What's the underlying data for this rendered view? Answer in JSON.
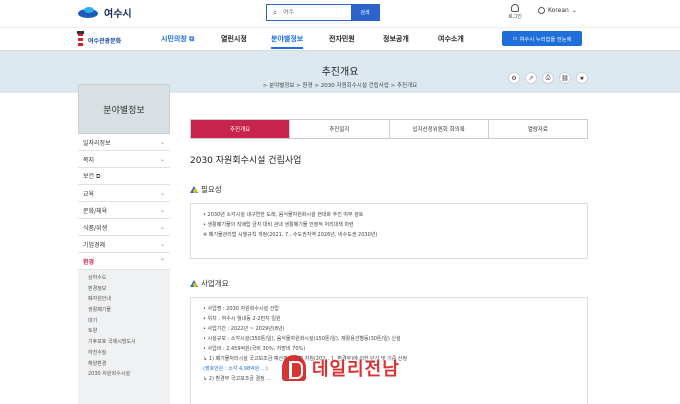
{
  "header": {
    "logo_text": "여수시",
    "search_placeholder": "여수",
    "search_button": "검색",
    "login_label": "로그인",
    "language_label": "Korean"
  },
  "nav": {
    "brand_label": "여수관광문화",
    "items": [
      {
        "label": "시민의창 ⧉"
      },
      {
        "label": "열린시정"
      },
      {
        "label": "분야별정보"
      },
      {
        "label": "전자민원"
      },
      {
        "label": "정보공개"
      },
      {
        "label": "여수소개"
      }
    ],
    "cta_label": "여수시 누리집을 한눈에"
  },
  "banner": {
    "title": "추진개요",
    "breadcrumb": "> 분야별정보 > 환경 > 2030 자원회수시설 건립사업 > 추진개요"
  },
  "sidebar": {
    "title": "분야별정보",
    "items": [
      {
        "label": "일자리정보"
      },
      {
        "label": "복지"
      },
      {
        "label": "보건 ⧉"
      },
      {
        "label": "교육"
      },
      {
        "label": "문화/체육"
      },
      {
        "label": "식품/위생"
      },
      {
        "label": "기업경제"
      },
      {
        "label": "환경"
      }
    ],
    "subitems": [
      "상하수도",
      "환경정보",
      "폐자원안내",
      "생활폐기물",
      "대기",
      "토양",
      "기후보호 국제시범도시",
      "하천수질",
      "해양환경",
      "2030 자원회수시설"
    ]
  },
  "tabs": [
    {
      "label": "추진개요"
    },
    {
      "label": "추진일지"
    },
    {
      "label": "입지선정위원회 회의록"
    },
    {
      "label": "열람자료"
    }
  ],
  "page_title": "2030 자원회수시설 건립사업",
  "section1": {
    "title": "필요성",
    "lines": [
      "• 2030년 소각시설 내구연한 도래, 음식물자원화시설 현대화 추진 여부 검토",
      "• 생활폐기물의 직매립 금지 대비 관내 생활폐기물 안정적 처리대책 마련",
      "※ 폐기물관리법 시행규칙 개정(2021. 7., 수도권지역 2026년, 비수도권 2030년)"
    ]
  },
  "section2": {
    "title": "사업개요",
    "lines": [
      "• 사업명 : 2030 자원회수시설 건립",
      "• 위치 : 여수시 월내동 2-2번지 일원",
      "• 사업기간 : 2022년 ~ 2029년(8년)",
      "• 시설규모 : 소각시설(350톤/일), 음식물자원화시설(150톤/일), 재활용선별동(30톤/일) 신설",
      "• 사업비 : 2,459억원(국비 30%, 지방비 70%)",
      "  ↳ 1) 폐기물처리시설 국고보조금 예산편성 관련 지침(202_. 1. 환경부)에 의한 단가 및 기준 산정",
      "    (괄호안은 : 소각 4,98억원 …)",
      "  ↳ 2) 환경부 국고보조금 결정 …"
    ]
  },
  "watermark": "데일리전남"
}
